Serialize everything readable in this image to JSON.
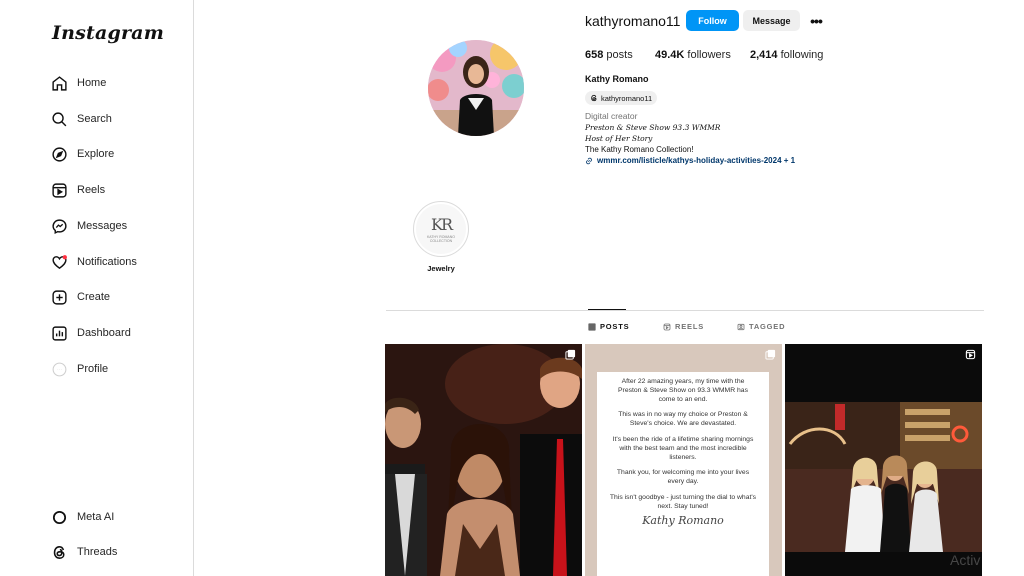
{
  "sidebar": {
    "logo": "Instagram",
    "items": [
      {
        "label": "Home",
        "icon": "home-icon"
      },
      {
        "label": "Search",
        "icon": "search-icon"
      },
      {
        "label": "Explore",
        "icon": "explore-icon"
      },
      {
        "label": "Reels",
        "icon": "reels-icon"
      },
      {
        "label": "Messages",
        "icon": "messages-icon"
      },
      {
        "label": "Notifications",
        "icon": "heart-icon"
      },
      {
        "label": "Create",
        "icon": "create-icon"
      },
      {
        "label": "Dashboard",
        "icon": "dashboard-icon"
      },
      {
        "label": "Profile",
        "icon": "profile-icon"
      }
    ],
    "bottom": [
      {
        "label": "Meta AI",
        "icon": "meta-ai-icon"
      },
      {
        "label": "Threads",
        "icon": "threads-icon"
      }
    ]
  },
  "profile": {
    "username": "kathyromano11",
    "follow_label": "Follow",
    "message_label": "Message",
    "posts_count": "658",
    "posts_label": "posts",
    "followers_count": "49.4K",
    "followers_label": "followers",
    "following_count": "2,414",
    "following_label": "following",
    "full_name": "Kathy Romano",
    "threads_handle": "kathyromano11",
    "category": "Digital creator",
    "bio_line1": "Preston & Steve Show 93.3 WMMR",
    "bio_line2": "Host of Her Story",
    "bio_line3": "The Kathy Romano Collection!",
    "link": "wmmr.com/listicle/kathys-holiday-activities-2024 + 1"
  },
  "highlights": [
    {
      "label": "Jewelry",
      "mark": "KR",
      "caption": "KATHY ROMANO COLLECTION"
    }
  ],
  "tabs": [
    {
      "label": "POSTS",
      "active": true
    },
    {
      "label": "REELS",
      "active": false
    },
    {
      "label": "TAGGED",
      "active": false
    }
  ],
  "post2": {
    "paragraphs": [
      "After 22 amazing years, my time with the Preston & Steve Show on 93.3 WMMR has come to an end.",
      "This was in no way my choice or Preston & Steve's choice. We are devastated.",
      "It's been the ride of a lifetime sharing mornings with the best team and the most incredible listeners.",
      "Thank you, for welcoming me into your lives every day.",
      "This isn't goodbye - just turning the dial to what's next. Stay tuned!"
    ],
    "signature": "Kathy Romano"
  },
  "watermark": "Activ",
  "colors": {
    "accent": "#0095f6",
    "link": "#00376b"
  }
}
